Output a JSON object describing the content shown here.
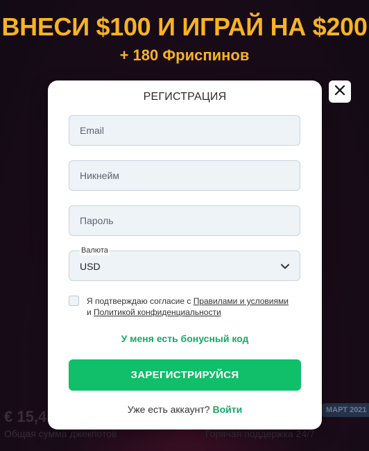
{
  "promo": {
    "title": "ВНЕСИ $100 И ИГРАЙ НА $200",
    "subtitle": "+ 180 Фриспинов"
  },
  "background": {
    "stat_value": "€ 15,4",
    "stat_label": "Общая сумма джекпотов",
    "support_label": "Горячая поддержка 24/7",
    "badge": "МАРТ 2021"
  },
  "modal": {
    "title": "РЕГИСТРАЦИЯ",
    "close_icon": "close-icon",
    "fields": {
      "email": {
        "placeholder": "Email",
        "value": ""
      },
      "nickname": {
        "placeholder": "Никнейм",
        "value": ""
      },
      "password": {
        "placeholder": "Пароль",
        "value": ""
      }
    },
    "currency": {
      "label": "Валюта",
      "selected": "USD",
      "icon": "chevron-down-icon"
    },
    "consent": {
      "checked": false,
      "prefix": "Я подтверждаю согласие с ",
      "terms_link": "Правилами и условиями",
      "middle": "и ",
      "privacy_link": "Политикой конфиденциальности"
    },
    "bonus_code_link": "У меня есть бонусный код",
    "submit_label": "ЗАРЕГИСТРИРУЙСЯ",
    "login_prompt": "Уже есть аккаунт? ",
    "login_link": "Войти"
  },
  "colors": {
    "accent_yellow": "#f7b323",
    "accent_green": "#0fbf69",
    "link_green": "#17a868",
    "field_bg": "#eef3f7"
  }
}
